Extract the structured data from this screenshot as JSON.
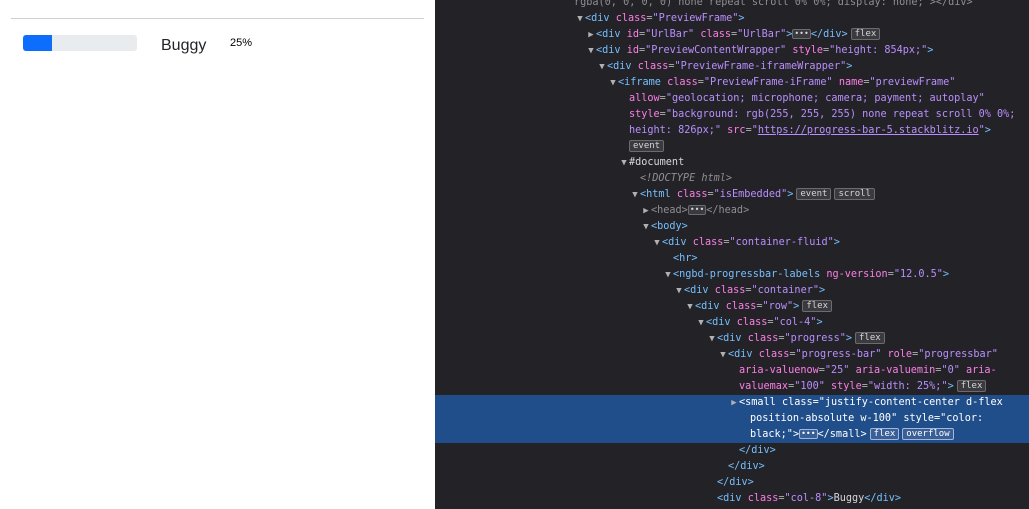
{
  "preview": {
    "progress_percent": 25,
    "progress_fill_color": "#0d6efd",
    "label": "Buggy",
    "percent_text": "25%"
  },
  "devtools": {
    "lines": [
      {
        "indent": 0,
        "html": "<span class=\"muted\">rgba(0, 0, 0, 0) none repeat scroll 0% 0%; display: none;\"&gt;&lt;/div&gt;</span>"
      },
      {
        "indent": 1,
        "tw": "▼",
        "html": "<span class=\"tag\">&lt;div</span> <span class=\"an\">class</span><span class=\"punc\">=</span><span class=\"av\">\"PreviewFrame\"</span><span class=\"tag\">&gt;</span>"
      },
      {
        "indent": 2,
        "tw": "▶",
        "html": "<span class=\"tag\">&lt;div</span> <span class=\"an\">id</span><span class=\"punc\">=</span><span class=\"av\">\"UrlBar\"</span> <span class=\"an\">class</span><span class=\"punc\">=</span><span class=\"av\">\"UrlBar\"</span><span class=\"tag\">&gt;</span><span class=\"ell\">•••</span><span class=\"tag\">&lt;/div&gt;</span><span class=\"badge\">flex</span>"
      },
      {
        "indent": 2,
        "tw": "▼",
        "html": "<span class=\"tag\">&lt;div</span> <span class=\"an\">id</span><span class=\"punc\">=</span><span class=\"av\">\"PreviewContentWrapper\"</span> <span class=\"an\">style</span><span class=\"punc\">=</span><span class=\"av\">\"height: 854px;\"</span><span class=\"tag\">&gt;</span>"
      },
      {
        "indent": 3,
        "tw": "▼",
        "html": "<span class=\"tag\">&lt;div</span> <span class=\"an\">class</span><span class=\"punc\">=</span><span class=\"av\">\"PreviewFrame-iframeWrapper\"</span><span class=\"tag\">&gt;</span>"
      },
      {
        "indent": 4,
        "tw": "▼",
        "html": "<span class=\"tag\">&lt;iframe</span> <span class=\"an\">class</span><span class=\"punc\">=</span><span class=\"av\">\"PreviewFrame-iFrame\"</span> <span class=\"an\">name</span><span class=\"punc\">=</span><span class=\"av\">\"previewFrame\"</span>"
      },
      {
        "indent": 5,
        "html": "<span class=\"an\">allow</span><span class=\"punc\">=</span><span class=\"av\">\"geolocation; microphone; camera; payment; autoplay\"</span>"
      },
      {
        "indent": 5,
        "html": "<span class=\"an\">style</span><span class=\"punc\">=</span><span class=\"av\">\"background: rgb(255, 255, 255) none repeat scroll 0% 0%;</span>"
      },
      {
        "indent": 5,
        "html": "<span class=\"av\">height: 826px;\"</span> <span class=\"an\">src</span><span class=\"punc\">=</span><span class=\"av\">\"</span><span class=\"link\">https://progress-bar-5.stackblitz.io</span><span class=\"av\">\"</span><span class=\"tag\">&gt;</span>"
      },
      {
        "indent": 5,
        "html": "<span class=\"badge\" style=\"margin-left:0\">event</span>"
      },
      {
        "indent": 5,
        "tw": "▼",
        "html": "<span class=\"txt\">#document</span>"
      },
      {
        "indent": 6,
        "html": "<span class=\"cm\">&lt;!DOCTYPE html&gt;</span>"
      },
      {
        "indent": 6,
        "tw": "▼",
        "html": "<span class=\"tag\">&lt;html</span> <span class=\"an\">class</span><span class=\"punc\">=</span><span class=\"av\">\"isEmbedded\"</span><span class=\"tag\">&gt;</span><span class=\"badge\">event</span><span class=\"badge\">scroll</span>"
      },
      {
        "indent": 7,
        "tw": "▶",
        "html": "<span class=\"muted\">&lt;head&gt;</span><span class=\"ell\">•••</span><span class=\"muted\">&lt;/head&gt;</span>"
      },
      {
        "indent": 7,
        "tw": "▼",
        "html": "<span class=\"tag\">&lt;body&gt;</span>"
      },
      {
        "indent": 8,
        "tw": "▼",
        "html": "<span class=\"tag\">&lt;div</span> <span class=\"an\">class</span><span class=\"punc\">=</span><span class=\"av\">\"container-fluid\"</span><span class=\"tag\">&gt;</span>"
      },
      {
        "indent": 9,
        "html": "<span class=\"tag\">&lt;hr&gt;</span>"
      },
      {
        "indent": 9,
        "tw": "▼",
        "html": "<span class=\"tag\">&lt;ngbd-progressbar-labels</span> <span class=\"an\">ng-version</span><span class=\"punc\">=</span><span class=\"av\">\"12.0.5\"</span><span class=\"tag\">&gt;</span>"
      },
      {
        "indent": 10,
        "tw": "▼",
        "html": "<span class=\"tag\">&lt;div</span> <span class=\"an\">class</span><span class=\"punc\">=</span><span class=\"av\">\"container\"</span><span class=\"tag\">&gt;</span>"
      },
      {
        "indent": 11,
        "tw": "▼",
        "html": "<span class=\"tag\">&lt;div</span> <span class=\"an\">class</span><span class=\"punc\">=</span><span class=\"av\">\"row\"</span><span class=\"tag\">&gt;</span><span class=\"badge\">flex</span>"
      },
      {
        "indent": 12,
        "tw": "▼",
        "html": "<span class=\"tag\">&lt;div</span> <span class=\"an\">class</span><span class=\"punc\">=</span><span class=\"av\">\"col-4\"</span><span class=\"tag\">&gt;</span>"
      },
      {
        "indent": 13,
        "tw": "▼",
        "html": "<span class=\"tag\">&lt;div</span> <span class=\"an\">class</span><span class=\"punc\">=</span><span class=\"av\">\"progress\"</span><span class=\"tag\">&gt;</span><span class=\"badge\">flex</span>"
      },
      {
        "indent": 14,
        "tw": "▼",
        "html": "<span class=\"tag\">&lt;div</span> <span class=\"an\">class</span><span class=\"punc\">=</span><span class=\"av\">\"progress-bar\"</span> <span class=\"an\">role</span><span class=\"punc\">=</span><span class=\"av\">\"progressbar\"</span>"
      },
      {
        "indent": 15,
        "html": "<span class=\"an\">aria-valuenow</span><span class=\"punc\">=</span><span class=\"av\">\"25\"</span> <span class=\"an\">aria-valuemin</span><span class=\"punc\">=</span><span class=\"av\">\"0\"</span> <span class=\"an\">aria-</span>"
      },
      {
        "indent": 15,
        "html": "<span class=\"an\">valuemax</span><span class=\"punc\">=</span><span class=\"av\">\"100\"</span> <span class=\"an\">style</span><span class=\"punc\">=</span><span class=\"av\">\"width: 25%;\"</span><span class=\"tag\">&gt;</span><span class=\"badge\">flex</span>"
      },
      {
        "indent": 15,
        "tw": "▶",
        "sel": true,
        "html": "<span class=\"tag\">&lt;small</span> <span class=\"an\">class</span><span class=\"punc\">=</span><span class=\"av\">\"justify-content-center d-flex</span>"
      },
      {
        "indent": 16,
        "sel": true,
        "html": "<span class=\"av\">position-absolute w-100\"</span> <span class=\"an\">style</span><span class=\"punc\">=</span><span class=\"av\">\"color:</span>"
      },
      {
        "indent": 16,
        "sel": true,
        "html": "<span class=\"av\">black;\"</span><span class=\"tag\">&gt;</span><span class=\"ell\">•••</span><span class=\"tag\">&lt;/small&gt;</span><span class=\"badge\">flex</span><span class=\"badge\">overflow</span>"
      },
      {
        "indent": 15,
        "html": "<span class=\"tag\">&lt;/div&gt;</span>"
      },
      {
        "indent": 14,
        "html": "<span class=\"tag\">&lt;/div&gt;</span>"
      },
      {
        "indent": 13,
        "html": "<span class=\"tag\">&lt;/div&gt;</span>"
      },
      {
        "indent": 13,
        "html": "<span class=\"tag\">&lt;div</span> <span class=\"an\">class</span><span class=\"punc\">=</span><span class=\"av\">\"col-8\"</span><span class=\"tag\">&gt;</span><span class=\"txt\">Buggy</span><span class=\"tag\">&lt;/div&gt;</span>"
      },
      {
        "indent": 12,
        "html": "<span class=\"tag\">&lt;/div&gt;</span>"
      }
    ]
  }
}
